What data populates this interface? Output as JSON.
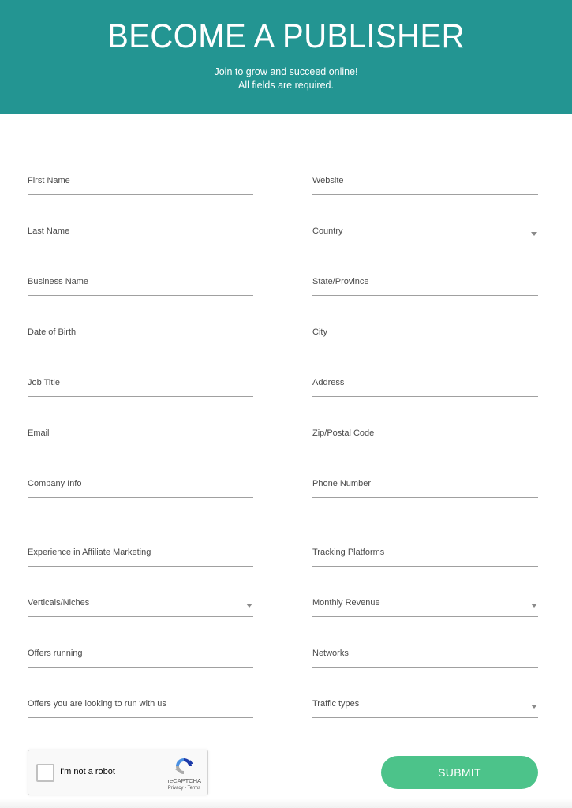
{
  "header": {
    "title": "BECOME A PUBLISHER",
    "subtitle": "Join to grow and succeed online!",
    "note": "All fields are required.",
    "background_color": "#239592"
  },
  "form": {
    "left_fields": [
      {
        "label": "First Name",
        "type": "text"
      },
      {
        "label": "Last Name",
        "type": "text"
      },
      {
        "label": "Business Name",
        "type": "text"
      },
      {
        "label": "Date of Birth",
        "type": "text"
      },
      {
        "label": "Job Title",
        "type": "text"
      },
      {
        "label": "Email",
        "type": "text"
      },
      {
        "label": "Company Info",
        "type": "text"
      },
      {
        "label": "Experience in Affiliate Marketing",
        "type": "text"
      },
      {
        "label": "Verticals/Niches",
        "type": "select"
      },
      {
        "label": "Offers running",
        "type": "text"
      },
      {
        "label": "Offers you are looking to run with us",
        "type": "text"
      }
    ],
    "right_fields": [
      {
        "label": "Website",
        "type": "text"
      },
      {
        "label": "Country",
        "type": "select"
      },
      {
        "label": "State/Province",
        "type": "text"
      },
      {
        "label": "City",
        "type": "text"
      },
      {
        "label": "Address",
        "type": "text"
      },
      {
        "label": "Zip/Postal Code",
        "type": "text"
      },
      {
        "label": "Phone Number",
        "type": "text"
      },
      {
        "label": "Tracking Platforms",
        "type": "text"
      },
      {
        "label": "Monthly Revenue",
        "type": "select"
      },
      {
        "label": "Networks",
        "type": "text"
      },
      {
        "label": "Traffic types",
        "type": "select"
      }
    ]
  },
  "captcha": {
    "label": "I'm not a robot",
    "brand": "reCAPTCHA",
    "links": "Privacy - Terms",
    "checked": false
  },
  "submit": {
    "label": "SUBMIT",
    "color": "#4cc38a"
  }
}
